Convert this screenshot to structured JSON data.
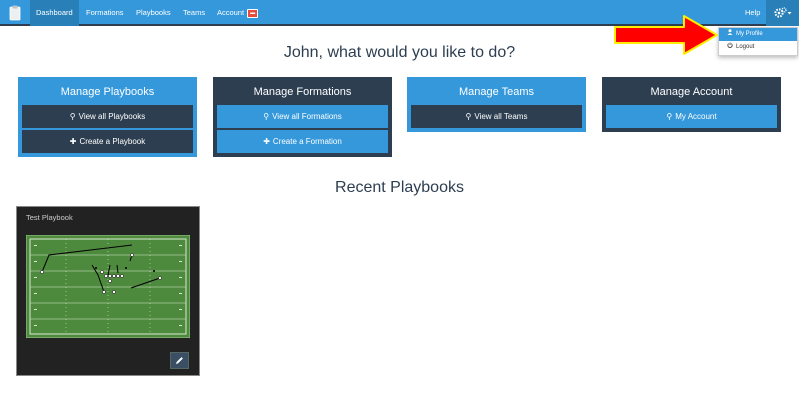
{
  "nav": {
    "items": [
      {
        "label": "Dashboard"
      },
      {
        "label": "Formations"
      },
      {
        "label": "Playbooks"
      },
      {
        "label": "Teams"
      },
      {
        "label": "Account"
      }
    ],
    "help_label": "Help"
  },
  "dropdown": {
    "items": [
      {
        "label": "My Profile"
      },
      {
        "label": "Logout"
      }
    ]
  },
  "greeting": "John, what would you like to do?",
  "panels": [
    {
      "title": "Manage Playbooks",
      "buttons": [
        {
          "label": "View all Playbooks"
        },
        {
          "label": "Create a Playbook"
        }
      ]
    },
    {
      "title": "Manage Formations",
      "buttons": [
        {
          "label": "View all Formations"
        },
        {
          "label": "Create a Formation"
        }
      ]
    },
    {
      "title": "Manage Teams",
      "buttons": [
        {
          "label": "View all Teams"
        }
      ]
    },
    {
      "title": "Manage Account",
      "buttons": [
        {
          "label": "My Account"
        }
      ]
    }
  ],
  "recent_heading": "Recent Playbooks",
  "playbooks": [
    {
      "title": "Test Playbook"
    }
  ],
  "colors": {
    "primary": "#3498db",
    "dark": "#2c3e50",
    "badge": "#e74c3c",
    "arrow": "#ff0000",
    "field": "#4e8a3e"
  }
}
